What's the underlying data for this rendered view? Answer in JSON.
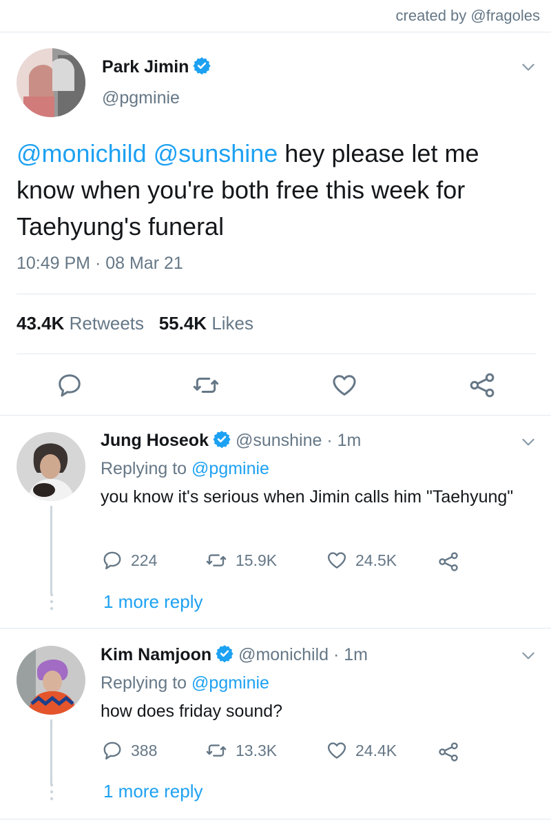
{
  "credit": "created by @fragoles",
  "main_tweet": {
    "name": "Park Jimin",
    "handle": "@pgminie",
    "mention1": "@monichild",
    "mention2": "@sunshine",
    "text": " hey please let me know when you're both free this week for Taehyung's funeral",
    "time": "10:49 PM · 08 Mar 21",
    "retweets_count": "43.4K",
    "retweets_label": "Retweets",
    "likes_count": "55.4K",
    "likes_label": "Likes"
  },
  "replies": [
    {
      "name": "Jung Hoseok",
      "handle": "@sunshine",
      "age": "1m",
      "replying_label": "Replying to",
      "replying_to": "@pgminie",
      "text": "you know it's serious when Jimin calls him \"Taehyung\"",
      "replies": "224",
      "retweets": "15.9K",
      "likes": "24.5K",
      "more_label": "1 more reply"
    },
    {
      "name": "Kim Namjoon",
      "handle": "@monichild",
      "age": "1m",
      "replying_label": "Replying to",
      "replying_to": "@pgminie",
      "text": "how does friday sound?",
      "replies": "388",
      "retweets": "13.3K",
      "likes": "24.4K",
      "more_label": "1 more reply"
    }
  ],
  "colors": {
    "accent": "#1da1f2",
    "muted": "#657786",
    "divider": "#e1e8ed"
  },
  "icons": [
    "verified-badge-icon",
    "chevron-down-icon",
    "reply-icon",
    "retweet-icon",
    "like-icon",
    "share-icon"
  ]
}
